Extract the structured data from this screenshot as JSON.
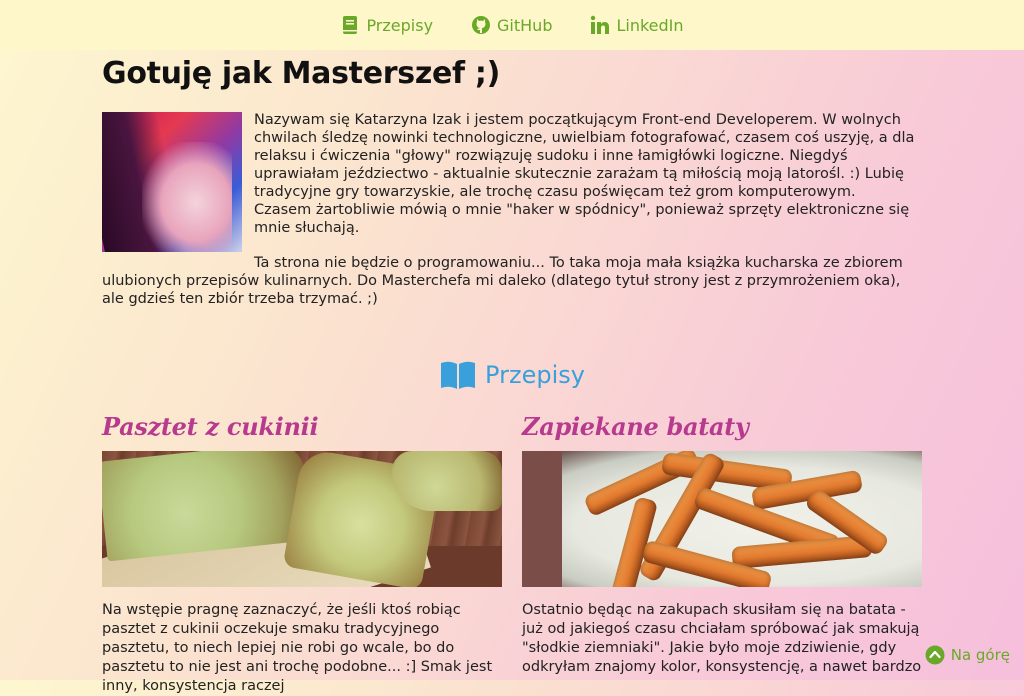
{
  "nav": {
    "items": [
      {
        "label": "Przepisy",
        "icon": "book-icon"
      },
      {
        "label": "GitHub",
        "icon": "github-icon"
      },
      {
        "label": "LinkedIn",
        "icon": "linkedin-icon"
      }
    ]
  },
  "page_title": "Gotuję jak Masterszef ;)",
  "about": {
    "paragraph1": "Nazywam się Katarzyna Izak i jestem początkującym Front-end Developerem. W wolnych chwilach śledzę nowinki technologiczne, uwielbiam fotografować, czasem coś uszyję, a dla relaksu i ćwiczenia \"głowy\" rozwiązuję sudoku i inne łamigłówki logiczne. Niegdyś uprawiałam jeździectwo - aktualnie skutecznie zarażam tą miłością moją latorośl. :) Lubię tradycyjne gry towarzyskie, ale trochę czasu poświęcam też grom komputerowym.",
    "paragraph1b": "Czasem żartobliwie mówią o mnie \"haker w spódnicy\", ponieważ sprzęty elektroniczne się mnie słuchają.",
    "paragraph2": "Ta strona nie będzie o programowaniu... To taka moja mała książka kucharska ze zbiorem ulubionych przepisów kulinarnych. Do Masterchefa mi daleko (dlatego tytuł strony jest z przymrożeniem oka), ale gdzieś ten zbiór trzeba trzymać. ;)"
  },
  "recipes_section": {
    "title": "Przepisy",
    "icon": "open-book-icon"
  },
  "recipes": [
    {
      "title": "Pasztet z cukinii",
      "text": "Na wstępie pragnę zaznaczyć, że jeśli ktoś robiąc pasztet z cukinii oczekuje smaku tradycyjnego pasztetu, to niech lepiej nie robi go wcale, bo do pasztetu to nie jest ani trochę podobne... :] Smak jest inny, konsystencja raczej"
    },
    {
      "title": "Zapiekane bataty",
      "text": "Ostatnio będąc na zakupach skusiłam się na batata - już od jakiegoś czasu chciałam spróbować jak smakują \"słodkie ziemniaki\". Jakie było moje zdziwienie, gdy odkryłam znajomy kolor, konsystencję, a nawet bardzo"
    }
  ],
  "back_to_top": {
    "label": "Na górę",
    "icon": "arrow-up-circle-icon"
  },
  "colors": {
    "accent_green": "#6aa829",
    "accent_blue": "#3aa0dc",
    "recipe_title": "#b83a8e"
  }
}
